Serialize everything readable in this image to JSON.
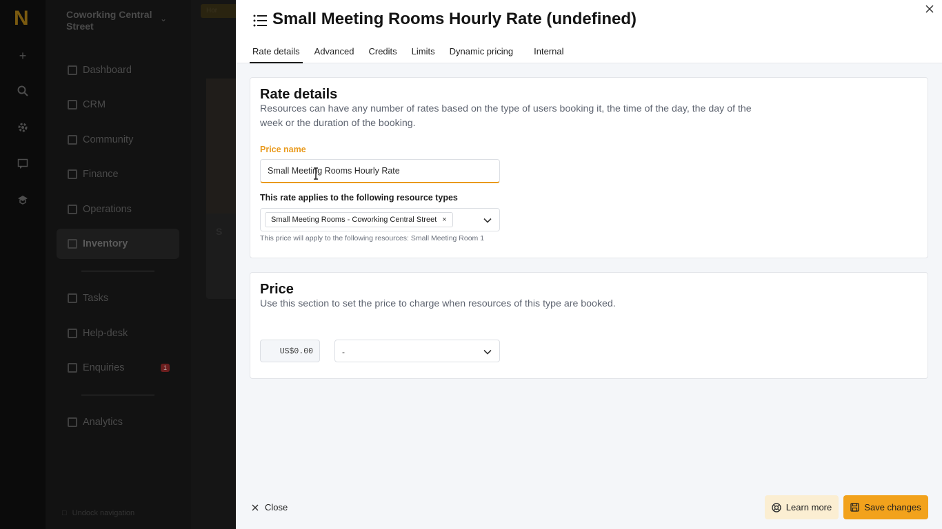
{
  "background_app": {
    "logo": "N",
    "org_name": "Coworking Central Street",
    "breadcrumb_partial": "Hor",
    "card_letter": "S",
    "nav_items": [
      {
        "label": "Dashboard",
        "icon": "dashboard-icon"
      },
      {
        "label": "CRM",
        "icon": "crm-icon"
      },
      {
        "label": "Community",
        "icon": "community-icon"
      },
      {
        "label": "Finance",
        "icon": "finance-icon"
      },
      {
        "label": "Operations",
        "icon": "operations-icon"
      },
      {
        "label": "Inventory",
        "icon": "inventory-icon",
        "active": true
      },
      {
        "label": "Tasks",
        "icon": "tasks-icon"
      },
      {
        "label": "Help-desk",
        "icon": "help-desk-icon"
      },
      {
        "label": "Enquiries",
        "icon": "enquiries-icon",
        "badge": "1"
      },
      {
        "label": "Analytics",
        "icon": "analytics-icon"
      }
    ],
    "undock_label": "Undock navigation"
  },
  "drawer": {
    "title": "Small Meeting Rooms Hourly Rate (undefined)",
    "tabs": [
      "Rate details",
      "Advanced",
      "Credits",
      "Limits",
      "Dynamic pricing",
      "Internal"
    ],
    "active_tab": "Rate details",
    "rate_details": {
      "heading": "Rate details",
      "description": "Resources can have any number of rates based on the type of users booking it, the time of the day, the day of the week or the duration of the booking.",
      "price_name_label": "Price name",
      "price_name_value": "Small Meeting Rooms Hourly Rate",
      "resource_types_label": "This rate applies to the following resource types",
      "resource_type_chip": "Small Meeting Rooms - Coworking Central Street",
      "chip_remove": "×",
      "helper_text": "This price will apply to the following resources: Small Meeting Room 1"
    },
    "price": {
      "heading": "Price",
      "description": "Use this section to set the price to charge when resources of this type are booked.",
      "amount": "US$0.00",
      "unit_selected": "-"
    },
    "footer": {
      "close_label": "Close",
      "learn_more_label": "Learn more",
      "save_label": "Save changes"
    }
  },
  "colors": {
    "accent": "#f2a21c",
    "accent_light": "#fbeed2",
    "label_orange": "#e99a1d"
  }
}
